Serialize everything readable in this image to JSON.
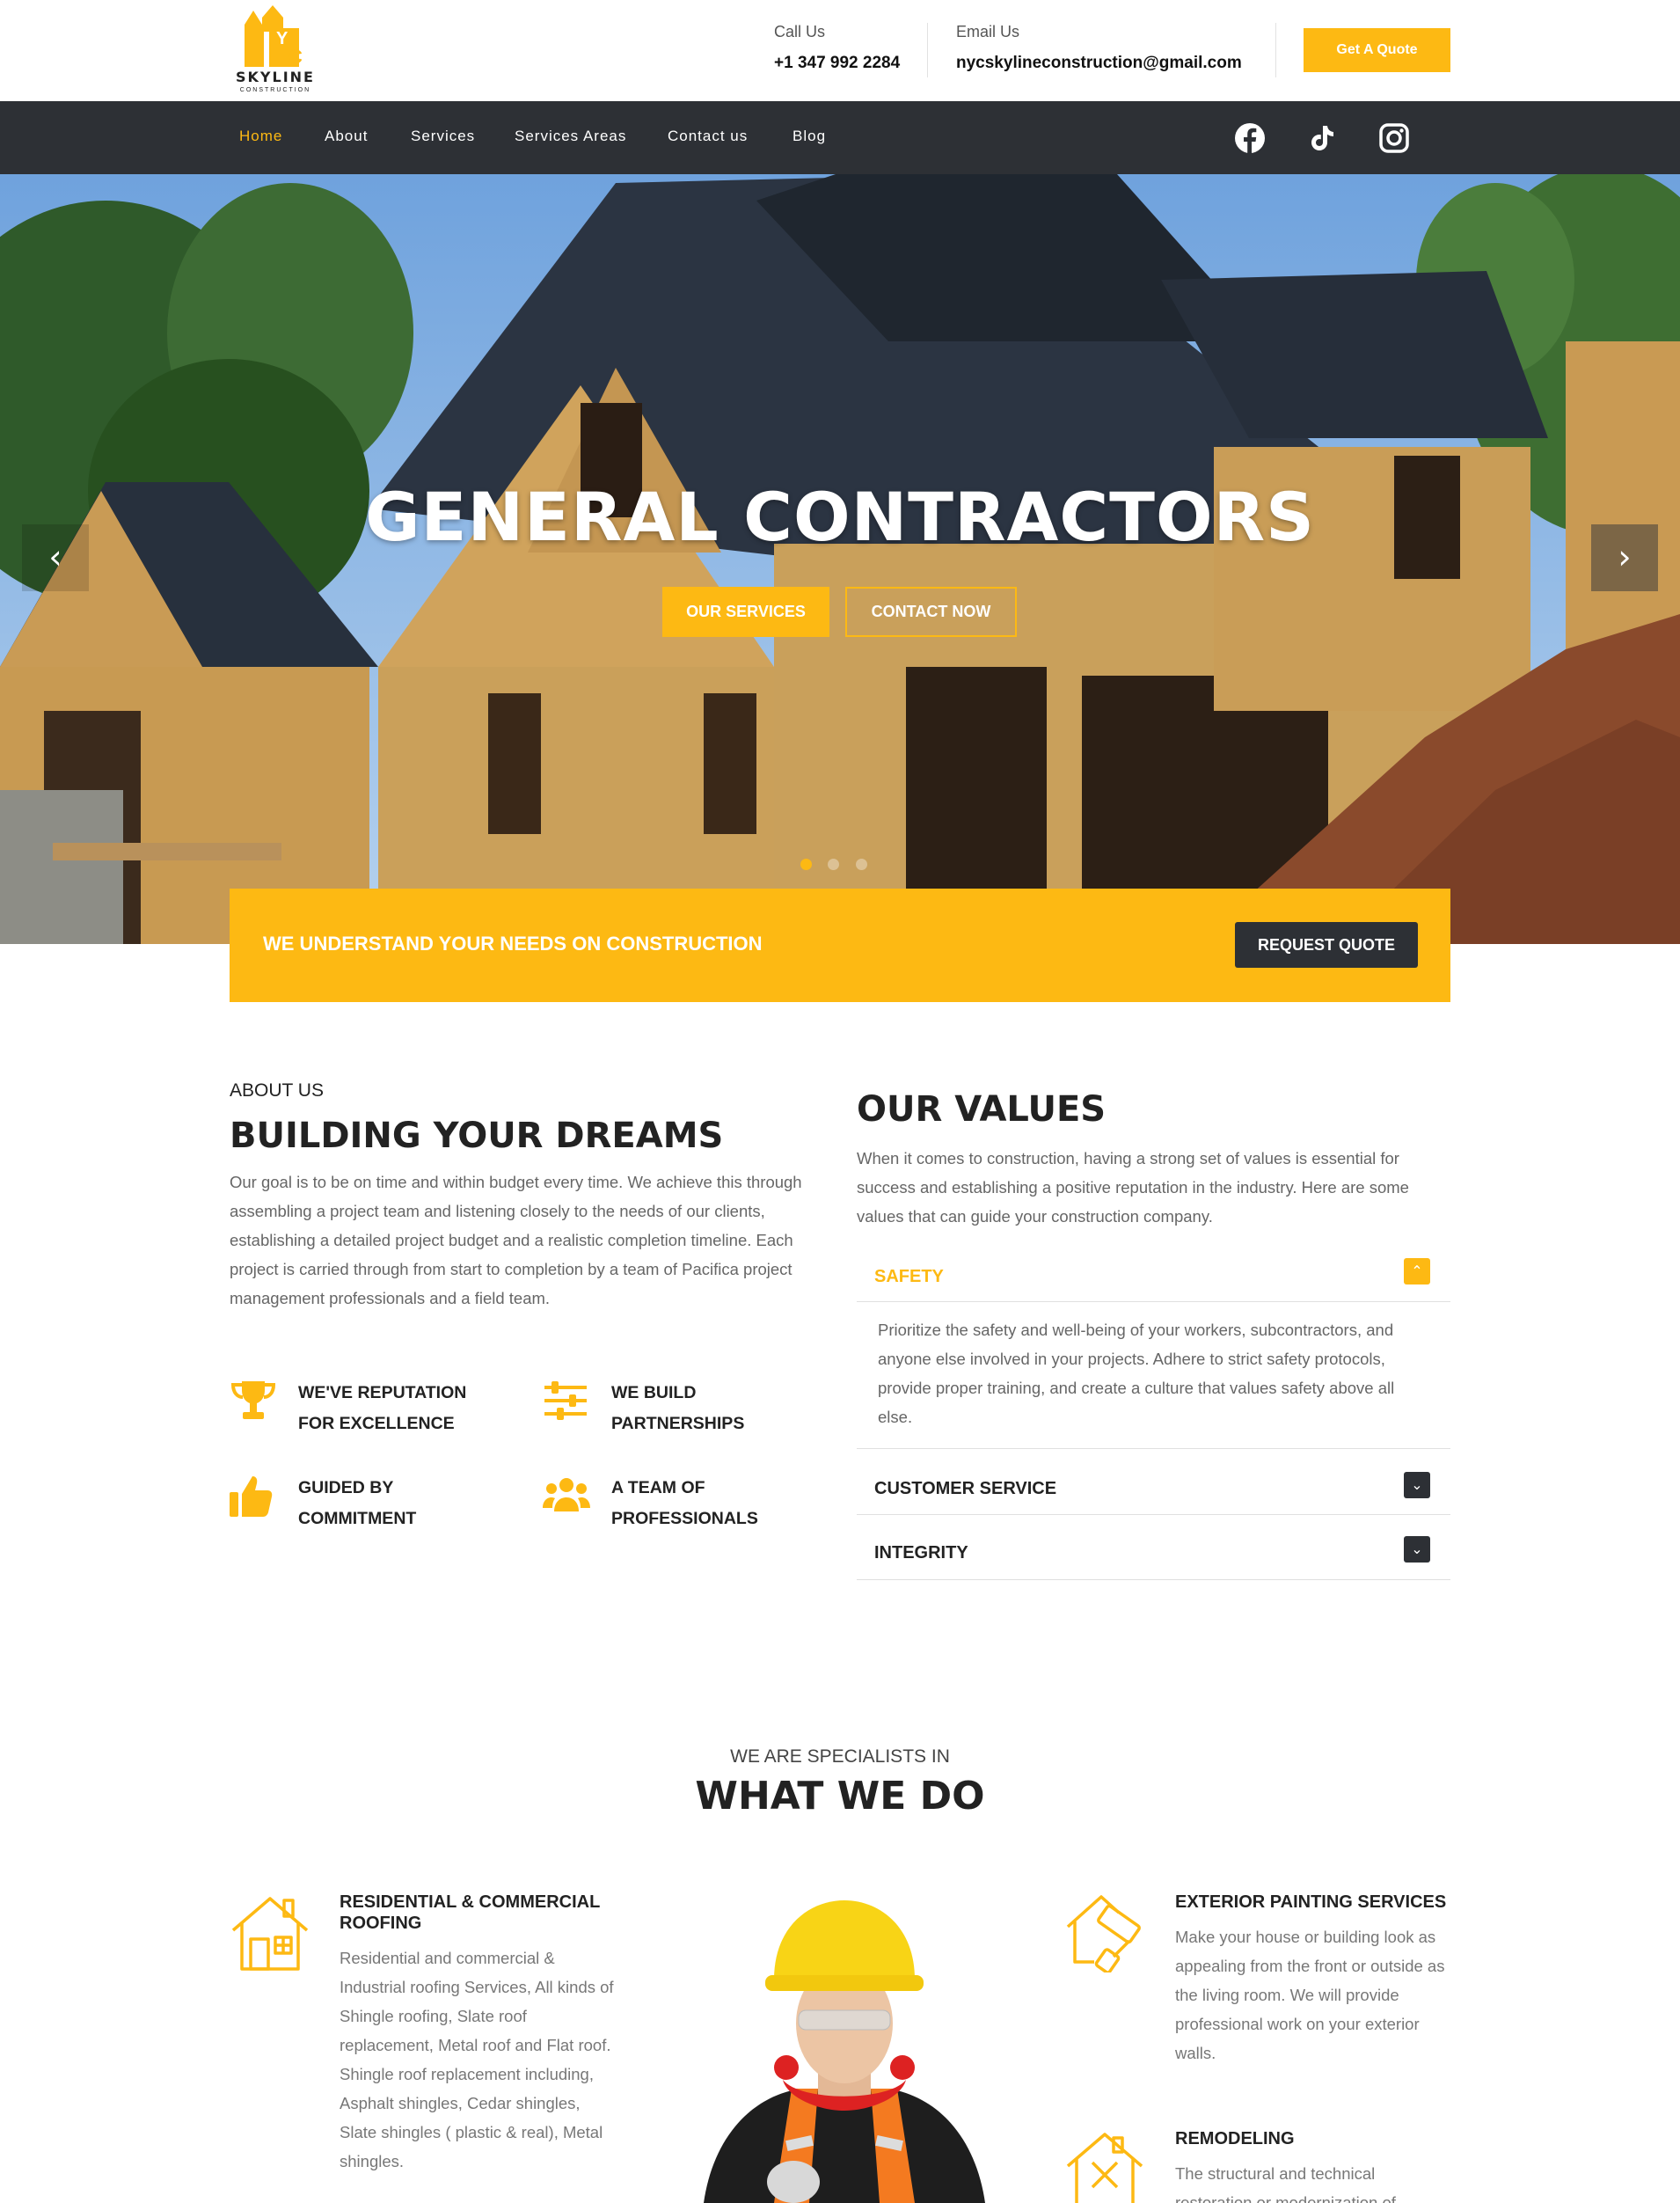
{
  "brand": {
    "logo_name": "SKYLINE",
    "logo_sub": "CONSTRUCTION",
    "logo_mark": "NYC"
  },
  "contact": {
    "call_label": "Call Us",
    "call_value": "+1 347 992 2284",
    "email_label": "Email Us",
    "email_value": "nycskylineconstruction@gmail.com"
  },
  "header": {
    "quote_button": "Get A Quote"
  },
  "nav": {
    "items": [
      "Home",
      "About",
      "Services",
      "Services Areas",
      "Contact us",
      "Blog"
    ],
    "active": "Home",
    "social": [
      "facebook-icon",
      "tiktok-icon",
      "instagram-icon"
    ]
  },
  "hero": {
    "title": "GENERAL CONTRACTORS",
    "button_primary": "OUR SERVICES",
    "button_secondary": "CONTACT NOW",
    "prev": "‹",
    "next": "›",
    "slides": 3,
    "active_slide": 1
  },
  "banner": {
    "text": "WE UNDERSTAND YOUR NEEDS ON CONSTRUCTION",
    "button": "REQUEST QUOTE"
  },
  "about": {
    "kicker": "ABOUT US",
    "title": "BUILDING YOUR DREAMS",
    "text": "Our goal is to be on time and within budget every time. We achieve this through assembling a project team and listening closely to the needs of our clients, establishing a detailed project budget and a realistic completion timeline. Each project is carried through from start to completion by a team of Pacifica project management professionals and a field team.",
    "features": [
      {
        "label": "WE'VE REPUTATION FOR EXCELLENCE",
        "icon": "trophy-icon"
      },
      {
        "label": "WE BUILD PARTNERSHIPS",
        "icon": "sliders-icon"
      },
      {
        "label": "GUIDED BY COMMITMENT",
        "icon": "thumbs-up-icon"
      },
      {
        "label": "A TEAM OF PROFESSIONALS",
        "icon": "users-icon"
      }
    ]
  },
  "values": {
    "title": "OUR VALUES",
    "text": "When it comes to construction, having a strong set of values is essential for success and establishing a positive reputation in the industry. Here are some values that can guide your construction company.",
    "accordion": [
      {
        "title": "SAFETY",
        "expanded": true,
        "body": "Prioritize the safety and well-being of your workers, subcontractors, and anyone else involved in your projects. Adhere to strict safety protocols, provide proper training, and create a culture that values safety above all else."
      },
      {
        "title": "CUSTOMER SERVICE",
        "expanded": false
      },
      {
        "title": "INTEGRITY",
        "expanded": false
      }
    ],
    "toggle_open": "⌃",
    "toggle_closed": "⌄"
  },
  "services": {
    "kicker": "WE ARE SPECIALISTS IN",
    "title": "WHAT WE DO",
    "items": [
      {
        "title": "RESIDENTIAL & COMMERCIAL ROOFING",
        "icon": "house-icon",
        "text": "Residential and commercial & Industrial roofing Services, All kinds of Shingle roofing, Slate roof replacement, Metal roof and Flat roof.\nShingle roof replacement including, Asphalt shingles, Cedar shingles, Slate shingles ( plastic & real), Metal shingles."
      },
      {
        "title": "EXTERIOR PAINTING SERVICES",
        "icon": "paint-roller-icon",
        "text": "Make your house or building look as appealing from the front or outside as the living room. We will provide professional work on your exterior walls."
      },
      {
        "title": "REMODELING",
        "icon": "house-tools-icon",
        "text": "The structural and technical restoration or modernization of"
      }
    ]
  },
  "colors": {
    "accent": "#fdb913",
    "dark": "#2d3035",
    "text": "#222222",
    "muted": "#666666"
  }
}
